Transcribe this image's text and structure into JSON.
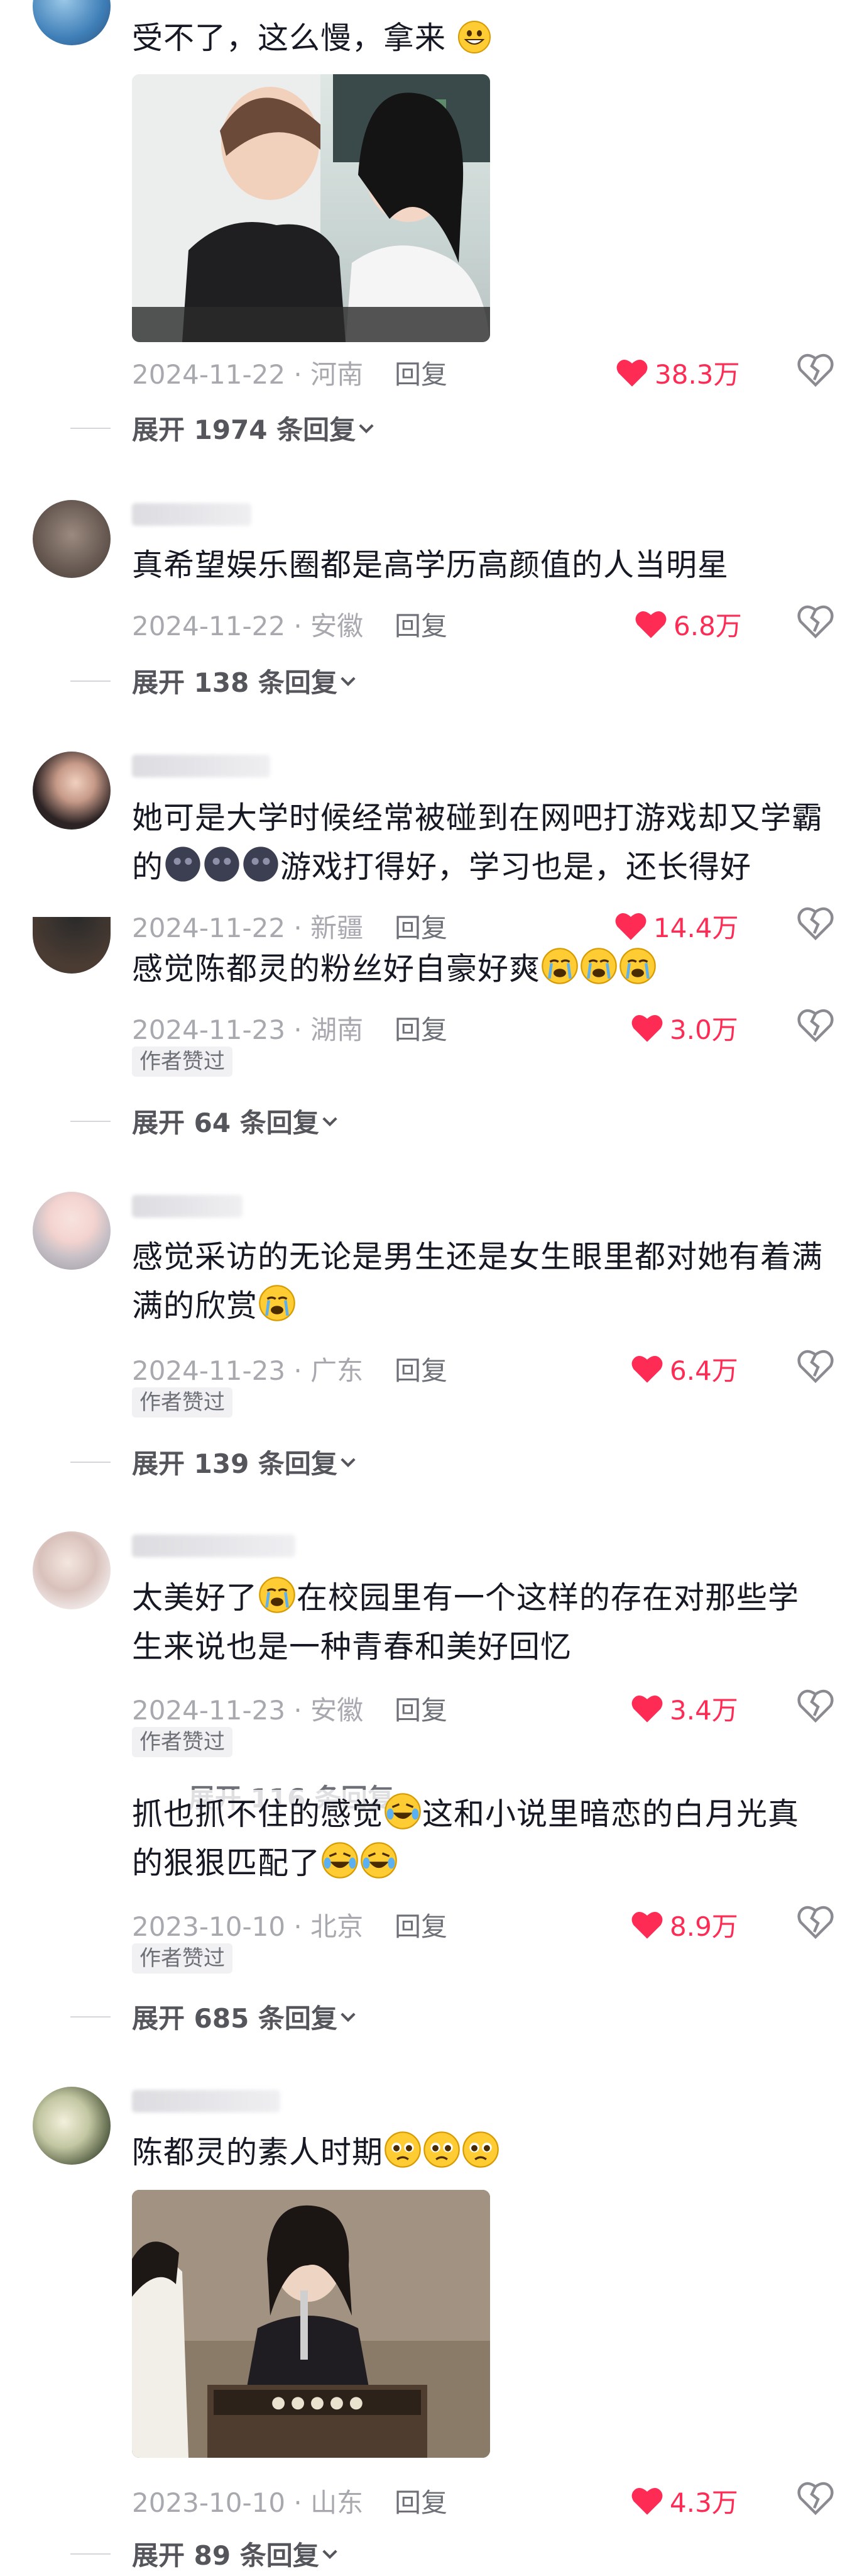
{
  "colors": {
    "like_red": "#fe2c55",
    "meta_gray": "#a7a9ae",
    "text": "#161823"
  },
  "comments": [
    {
      "text": "受不了，这么慢，拿来",
      "emoji": "grinning-face-emoji",
      "has_image": true,
      "date_loc": "2024-11-22 · 河南",
      "reply": "回复",
      "likes": "38.3万",
      "expand": "展开 1974 条回复"
    },
    {
      "text": "真希望娱乐圈都是高学历高颜值的人当明星",
      "date_loc": "2024-11-22 · 安徽",
      "reply": "回复",
      "likes": "6.8万",
      "expand": "展开 138 条回复"
    },
    {
      "text_a": "她可是大学时候经常被碰到在网吧打游戏却又学霸",
      "text_b_prefix": "的",
      "text_b_suffix": "游戏打得好，学习也是，还长得好",
      "date_loc": "2024-11-22 · 新疆",
      "reply": "回复",
      "likes": "14.4万"
    },
    {
      "text": "感觉陈都灵的粉丝好自豪好爽",
      "date_loc": "2024-11-23 · 湖南",
      "reply": "回复",
      "likes": "3.0万",
      "author_tag": "作者赞过",
      "expand": "展开 64 条回复"
    },
    {
      "text_a": "感觉采访的无论是男生还是女生眼里都对她有着满",
      "text_b": "满的欣赏",
      "date_loc": "2024-11-23 · 广东",
      "reply": "回复",
      "likes": "6.4万",
      "author_tag": "作者赞过",
      "expand": "展开 139 条回复"
    },
    {
      "text_a_prefix": "太美好了",
      "text_a_suffix": "在校园里有一个这样的存在对那些学",
      "text_b": "生来说也是一种青春和美好回忆",
      "date_loc": "2024-11-23 · 安徽",
      "reply": "回复",
      "likes": "3.4万",
      "author_tag": "作者赞过",
      "expand_hidden": "展开 116 条回复"
    },
    {
      "text_a_prefix": "抓也抓不住的感觉",
      "text_a_suffix": "这和小说里暗恋的白月光真",
      "text_b": "的狠狠匹配了",
      "date_loc": "2023-10-10 · 北京",
      "reply": "回复",
      "likes": "8.9万",
      "author_tag": "作者赞过",
      "expand": "展开 685 条回复"
    },
    {
      "text": "陈都灵的素人时期",
      "has_image": true,
      "date_loc": "2023-10-10 · 山东",
      "reply": "回复",
      "likes": "4.3万",
      "expand": "展开 89 条回复"
    }
  ]
}
